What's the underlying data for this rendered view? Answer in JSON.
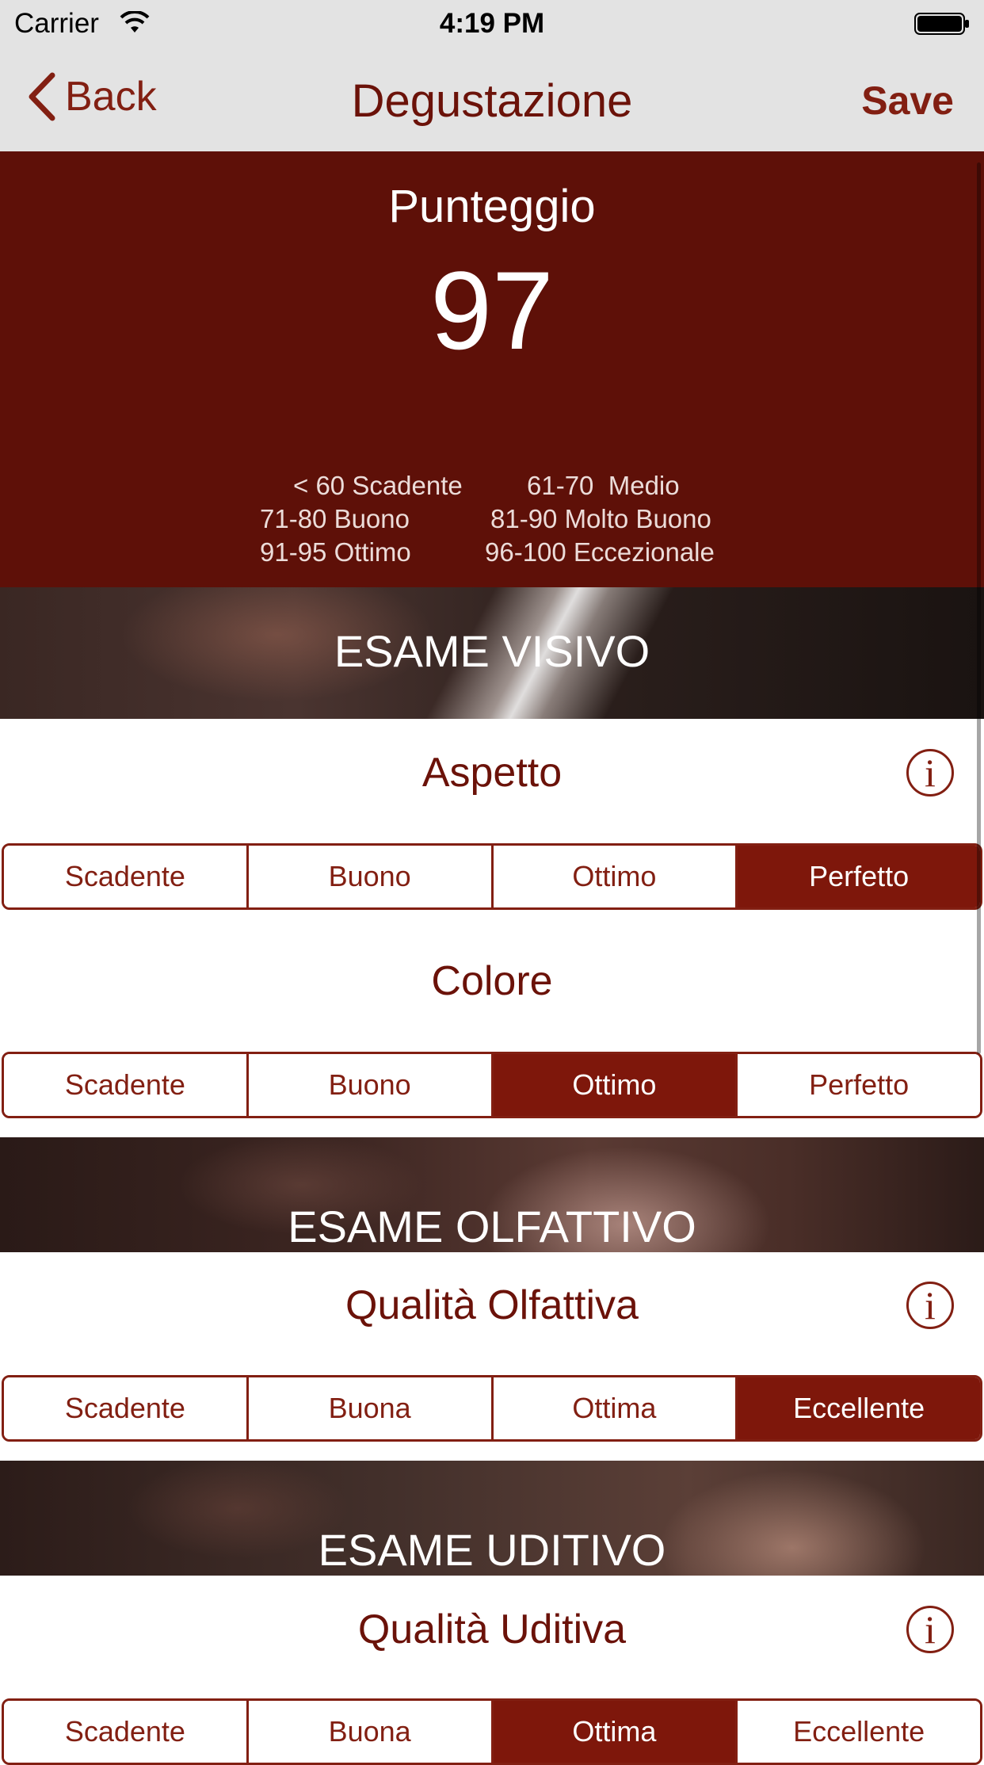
{
  "status_bar": {
    "carrier": "Carrier",
    "time": "4:19 PM"
  },
  "nav": {
    "back_label": "Back",
    "title": "Degustazione",
    "save_label": "Save"
  },
  "score": {
    "label": "Punteggio",
    "value": "97",
    "scale": [
      {
        "left": "< 60 Scadente",
        "right": "61-70  Medio"
      },
      {
        "left": "71-80 Buono",
        "right": "81-90 Molto Buono"
      },
      {
        "left": "91-95 Ottimo",
        "right": "96-100 Eccezionale"
      }
    ]
  },
  "sections": [
    {
      "title": "ESAME VISIVO",
      "fields": [
        {
          "title": "Aspetto",
          "info": "i",
          "options": [
            "Scadente",
            "Buono",
            "Ottimo",
            "Perfetto"
          ],
          "selected": "Perfetto"
        },
        {
          "title": "Colore",
          "options": [
            "Scadente",
            "Buono",
            "Ottimo",
            "Perfetto"
          ],
          "selected": "Ottimo"
        }
      ]
    },
    {
      "title": "ESAME OLFATTIVO",
      "fields": [
        {
          "title": "Qualità Olfattiva",
          "info": "i",
          "options": [
            "Scadente",
            "Buona",
            "Ottima",
            "Eccellente"
          ],
          "selected": "Eccellente"
        }
      ]
    },
    {
      "title": "ESAME UDITIVO",
      "fields": [
        {
          "title": "Qualità Uditiva",
          "info": "i",
          "options": [
            "Scadente",
            "Buona",
            "Ottima",
            "Eccellente"
          ],
          "selected": "Ottima"
        }
      ]
    }
  ],
  "colors": {
    "accent": "#821f12",
    "score_bg": "#5e1008",
    "selected_bg": "#7e170b",
    "bar_bg": "#e3e3e3"
  }
}
